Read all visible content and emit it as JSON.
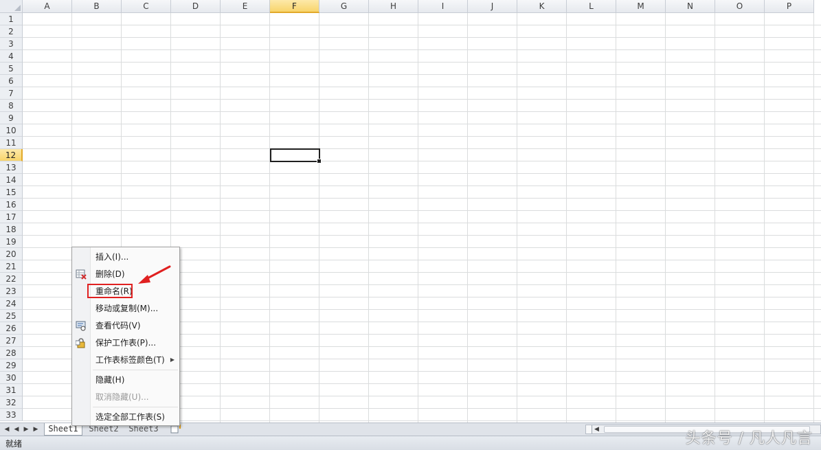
{
  "columns": [
    "A",
    "B",
    "C",
    "D",
    "E",
    "F",
    "G",
    "H",
    "I",
    "J",
    "K",
    "L",
    "M",
    "N",
    "O",
    "P"
  ],
  "active_column": "F",
  "rows": [
    "1",
    "2",
    "3",
    "4",
    "5",
    "6",
    "7",
    "8",
    "9",
    "10",
    "11",
    "12",
    "13",
    "14",
    "15",
    "16",
    "17",
    "18",
    "19",
    "20",
    "21",
    "22",
    "23",
    "24",
    "25",
    "26",
    "27",
    "28",
    "29",
    "30",
    "31",
    "32",
    "33"
  ],
  "active_row": "12",
  "sheet_tabs": [
    {
      "label": "Sheet1",
      "active": true
    },
    {
      "label": "Sheet2",
      "active": false
    },
    {
      "label": "Sheet3",
      "active": false
    }
  ],
  "context_menu": {
    "items": [
      {
        "label": "插入(I)...",
        "icon": "none",
        "disabled": false
      },
      {
        "label": "删除(D)",
        "icon": "delete-sheet-icon",
        "disabled": false
      },
      {
        "label": "重命名(R)",
        "icon": "none",
        "disabled": false,
        "highlighted": true
      },
      {
        "label": "移动或复制(M)...",
        "icon": "none",
        "disabled": false
      },
      {
        "label": "查看代码(V)",
        "icon": "view-code-icon",
        "disabled": false
      },
      {
        "label": "保护工作表(P)...",
        "icon": "lock-icon",
        "disabled": false
      },
      {
        "label": "工作表标签颜色(T)",
        "icon": "none",
        "disabled": false,
        "submenu": true
      },
      {
        "label": "隐藏(H)",
        "icon": "none",
        "disabled": false
      },
      {
        "label": "取消隐藏(U)...",
        "icon": "none",
        "disabled": true
      },
      {
        "label": "选定全部工作表(S)",
        "icon": "none",
        "disabled": false
      }
    ]
  },
  "status": {
    "text": "就绪"
  },
  "watermark": "头条号 / 凡人凡言",
  "colors": {
    "highlight_box": "#e02020",
    "arrow": "#e02020",
    "active_header": "#f8d46b"
  }
}
